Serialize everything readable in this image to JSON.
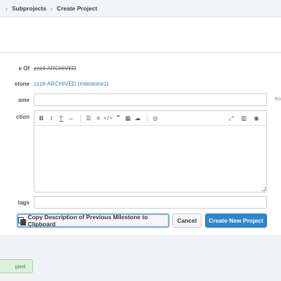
{
  "breadcrumb": {
    "items": [
      "Subprojects",
      "Create Project"
    ]
  },
  "form": {
    "clone_of": {
      "label": "e Of",
      "value": "zzz4-ARCHIVED"
    },
    "milestone": {
      "label": "stone",
      "value": "zzz4-ARCHIVED (milestone1)"
    },
    "name": {
      "label": "ame",
      "value": "",
      "side_hint": "Ro"
    },
    "description": {
      "label": "ction",
      "value": "",
      "toolbar": {
        "left_icons": [
          "bold-icon",
          "italic-icon",
          "strikethrough-icon",
          "link-icon",
          "bullet-list-icon",
          "numbered-list-icon",
          "code-icon",
          "quote-icon",
          "table-icon",
          "upload-icon",
          "help-icon"
        ],
        "right_icons": [
          "fullscreen-icon",
          "side-by-side-icon",
          "preview-icon"
        ]
      }
    },
    "tags": {
      "label": "tags",
      "value": ""
    }
  },
  "buttons": {
    "copy": "Copy Description of Previous Milestone to Clipboard",
    "cancel": "Cancel",
    "create": "Create New Project"
  },
  "toast": {
    "text": "pied."
  },
  "colors": {
    "primary": "#2d86cf",
    "link": "#2f7fc4",
    "toast_bg": "#dff1de",
    "toast_text": "#3b7a36"
  }
}
